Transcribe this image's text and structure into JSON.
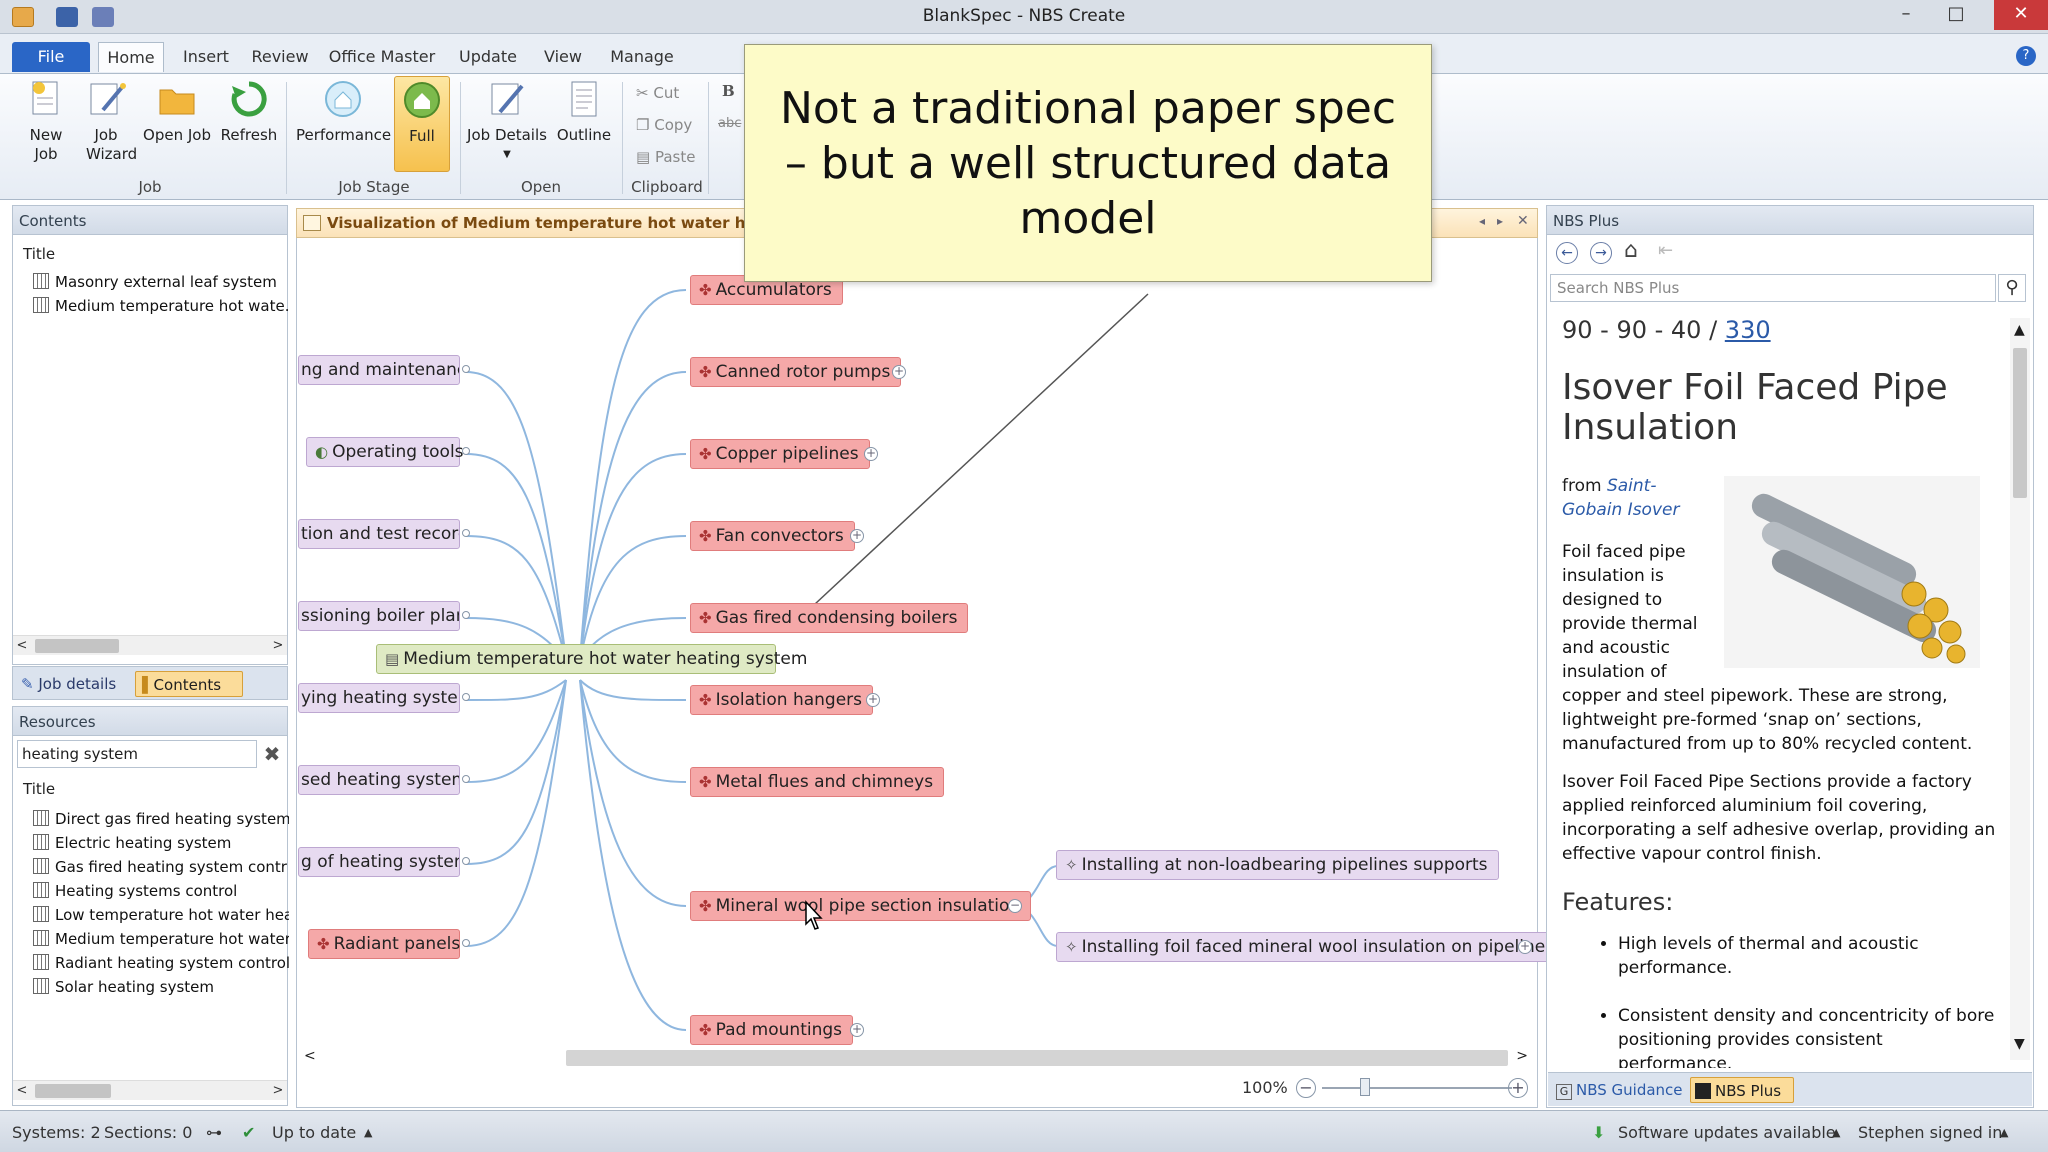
{
  "window": {
    "title": "BlankSpec  - NBS Create",
    "controls": {
      "minimize": "–",
      "maximize": "□",
      "close": "✕"
    }
  },
  "ribbon": {
    "tabs": [
      "File",
      "Home",
      "Insert",
      "Review",
      "Office Master",
      "Update",
      "View",
      "Manage"
    ],
    "groups": {
      "job": {
        "label": "Job",
        "new_job": "New Job",
        "job_wizard": "Job Wizard",
        "open_job": "Open Job",
        "refresh": "Refresh"
      },
      "job_stage": {
        "label": "Job Stage",
        "performance": "Performance",
        "full": "Full"
      },
      "open": {
        "label": "Open",
        "job_details": "Job Details",
        "outline": "Outline"
      },
      "clipboard": {
        "label": "Clipboard",
        "cut": "Cut",
        "copy": "Copy",
        "paste": "Paste"
      }
    },
    "bold": "B",
    "strike": "abc"
  },
  "callout": {
    "text": "Not a traditional paper spec – but a well structured data model"
  },
  "contents": {
    "header": "Contents",
    "column": "Title",
    "items": [
      "Masonry external leaf system",
      "Medium temperature hot wate..."
    ]
  },
  "left_tabs": {
    "job_details": "Job details",
    "contents": "Contents"
  },
  "resources": {
    "header": "Resources",
    "search_value": "heating system",
    "column": "Title",
    "items": [
      "Direct gas fired heating system",
      "Electric heating system",
      "Gas fired heating system contr",
      "Heating systems control",
      "Low temperature hot water hea",
      "Medium temperature hot water",
      "Radiant heating system control",
      "Solar heating system"
    ]
  },
  "canvas": {
    "header": "Visualization of Medium temperature hot water heating s",
    "center_node": "Medium temperature hot water heating system",
    "left_nodes": [
      "ng and maintenance",
      "Operating tools",
      "tion and test records",
      "ssioning boiler plant",
      "ying heating systems",
      "sed heating systems",
      "g of heating systems",
      "Radiant panels"
    ],
    "right_nodes": [
      "Accumulators",
      "Canned rotor pumps",
      "Copper pipelines",
      "Fan convectors",
      "Gas fired condensing boilers",
      "Isolation hangers",
      "Metal flues and chimneys",
      "Mineral wool pipe section insulation",
      "Pad mountings"
    ],
    "sub_nodes": [
      "Installing at non-loadbearing pipelines supports",
      "Installing foil faced mineral wool insulation on pipelines"
    ],
    "zoom": "100%"
  },
  "nbs_plus": {
    "header": "NBS Plus",
    "search_placeholder": "Search NBS Plus",
    "ref_prefix": "90 - 90 - 40 / ",
    "ref_link": "330",
    "title": "Isover Foil Faced Pipe Insulation",
    "from_label": "from",
    "manufacturer": "Saint-Gobain Isover",
    "para1": "Foil faced pipe insulation is designed to provide thermal and acoustic insulation of copper and steel pipework. These are strong, lightweight pre-formed ‘snap on’ sections, manufactured from up to 80% recycled content.",
    "para2": "Isover Foil Faced Pipe Sections provide a factory applied reinforced aluminium foil covering, incorporating a self adhesive overlap, providing an effective vapour control finish.",
    "features_title": "Features:",
    "features": [
      "High levels of thermal and acoustic performance.",
      "Consistent density and concentricity of bore positioning provides consistent performance."
    ],
    "bottom_tabs": {
      "guidance": "NBS Guidance",
      "plus": "NBS Plus"
    }
  },
  "status": {
    "systems": "Systems: 2",
    "sections": "Sections: 0",
    "up_to_date": "Up to date",
    "updates": "Software updates available",
    "user": "Stephen signed in"
  },
  "colors": {
    "node_red": "#f5a8a8",
    "node_purple": "#e7daf0",
    "node_green": "#dfeac4",
    "callout": "#fdfbc8",
    "file_tab": "#2a66c6"
  }
}
